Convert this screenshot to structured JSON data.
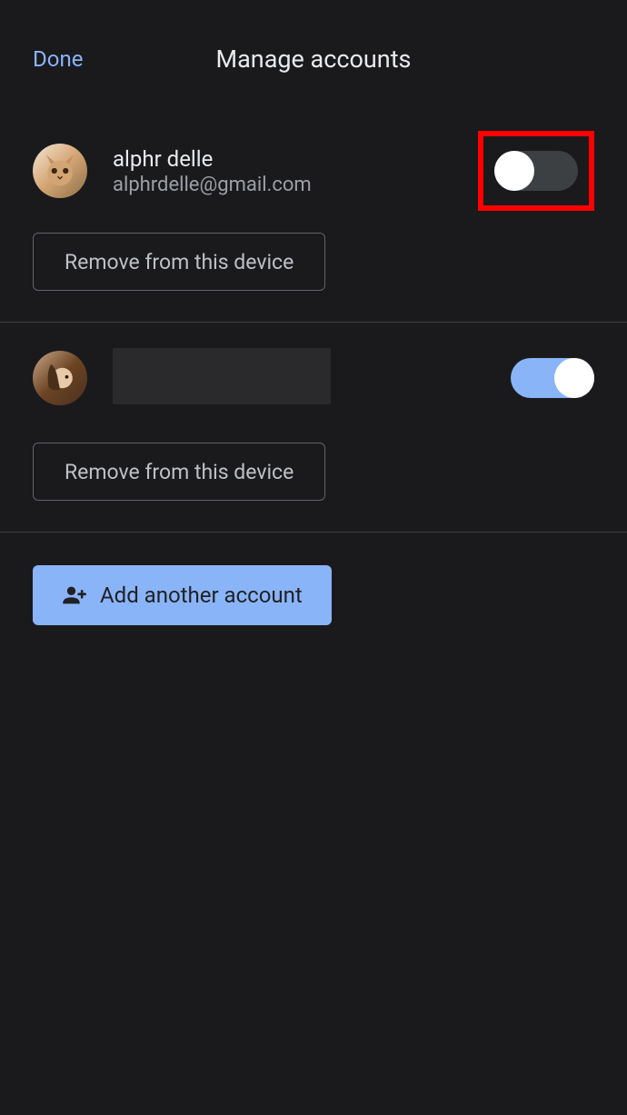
{
  "header": {
    "done_label": "Done",
    "title": "Manage accounts"
  },
  "accounts": [
    {
      "name": "alphr delle",
      "email": "alphrdelle@gmail.com",
      "enabled": false,
      "highlighted": true
    },
    {
      "name": "",
      "email": "",
      "enabled": true,
      "highlighted": false,
      "blurred": true
    }
  ],
  "remove_button_label": "Remove from this device",
  "add_button_label": "Add another account"
}
